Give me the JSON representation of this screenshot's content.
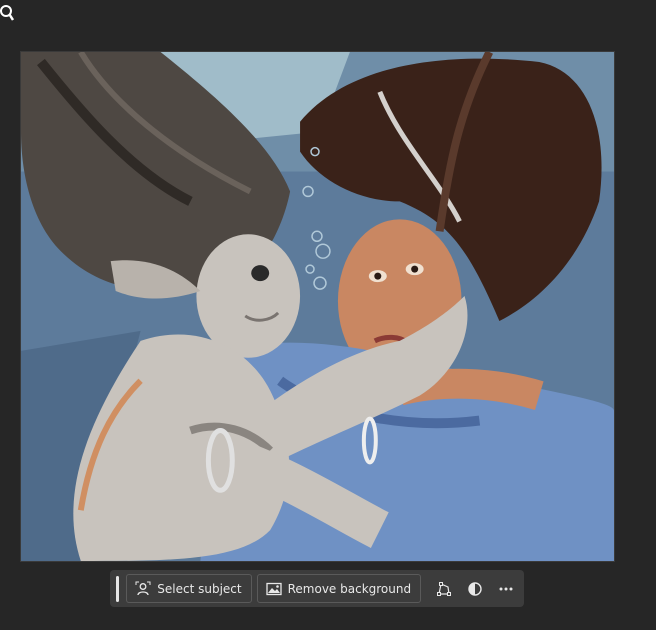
{
  "cursor": {
    "icon": "zoom-tool-icon"
  },
  "canvas": {
    "description_icon": "artwork-image",
    "palette": {
      "water": "#5c7a9a",
      "light_water": "#a9c4cf",
      "mermaid_skin": "#c8c3bd",
      "mermaid_hair": "#4e4843",
      "woman_hair": "#3a2219",
      "woman_skin": "#c98762",
      "dress": "#6f91c4"
    }
  },
  "context_bar": {
    "select_subject_label": "Select subject",
    "select_subject_icon": "person-select-icon",
    "remove_background_label": "Remove background",
    "remove_background_icon": "image-remove-icon",
    "transform_icon": "transform-icon",
    "adjust_icon": "half-circle-adjust-icon",
    "more_icon": "more-options-icon"
  }
}
